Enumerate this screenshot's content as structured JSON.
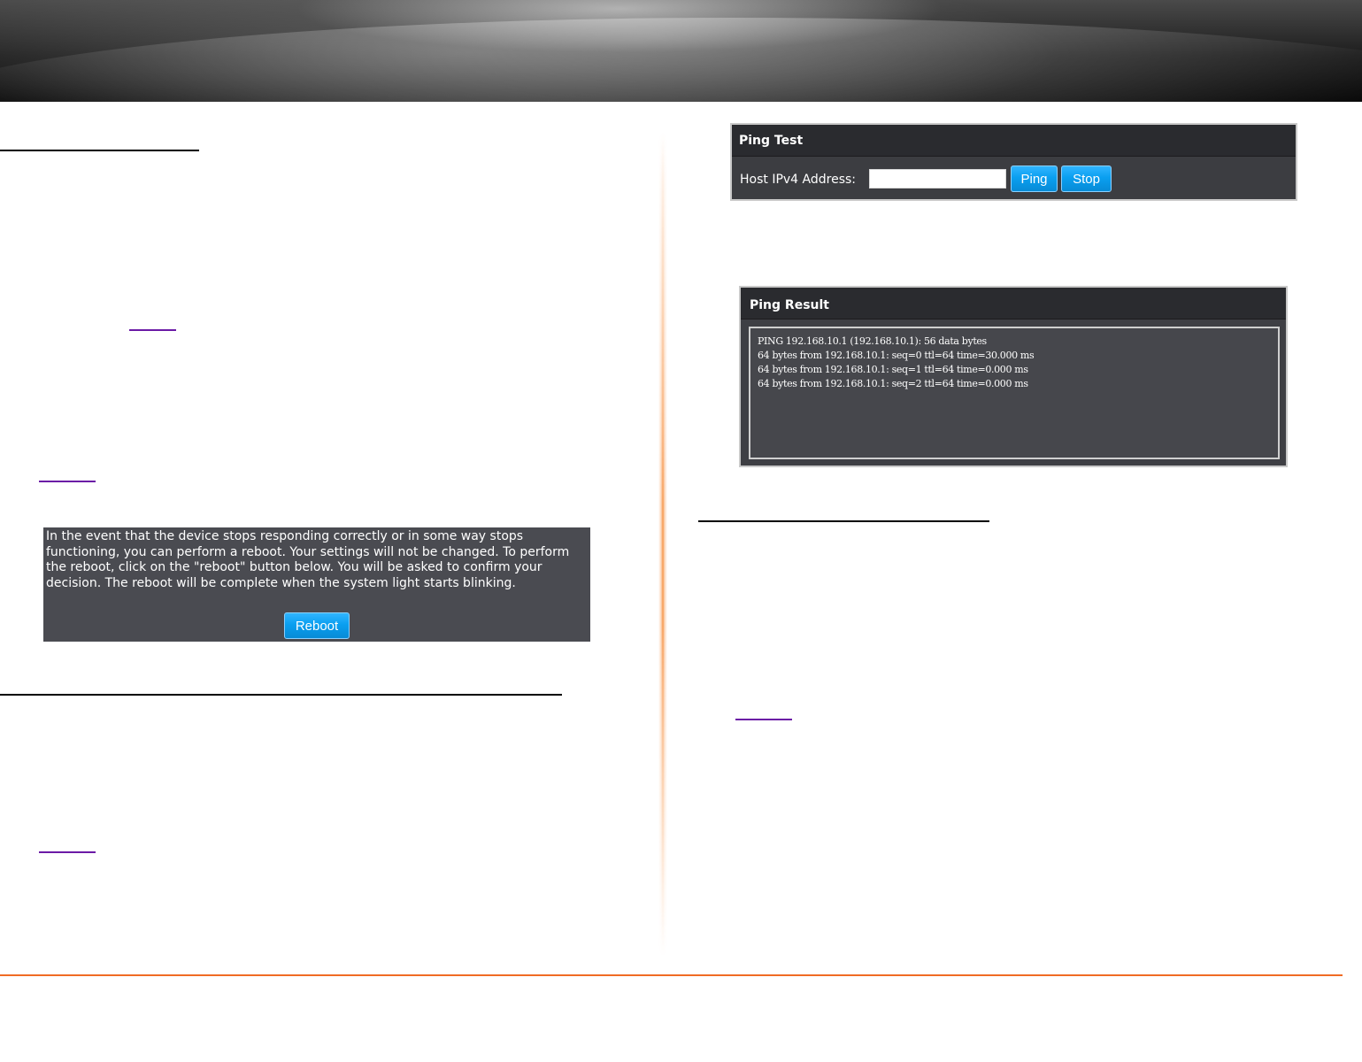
{
  "reboot": {
    "description": "In the event that the device stops responding correctly or in some way stops functioning, you can perform a reboot. Your settings will not be changed. To perform the reboot, click on the \"reboot\" button below. You will be asked to confirm your decision. The reboot will be complete when the system light starts blinking.",
    "button_label": "Reboot"
  },
  "ping_test": {
    "title": "Ping Test",
    "host_label": "Host IPv4 Address:",
    "host_value": "",
    "ping_label": "Ping",
    "stop_label": "Stop"
  },
  "ping_result": {
    "title": "Ping Result",
    "lines": [
      "PING 192.168.10.1 (192.168.10.1): 56 data bytes",
      "64 bytes from 192.168.10.1: seq=0 ttl=64 time=30.000 ms",
      "64 bytes from 192.168.10.1: seq=1 ttl=64 time=0.000 ms",
      "64 bytes from 192.168.10.1: seq=2 ttl=64 time=0.000 ms"
    ]
  },
  "colors": {
    "accent_orange": "#f06b24",
    "button_blue": "#0a9ff0",
    "panel_dark": "#3c3d41",
    "link_purple": "#6b1aa6"
  }
}
